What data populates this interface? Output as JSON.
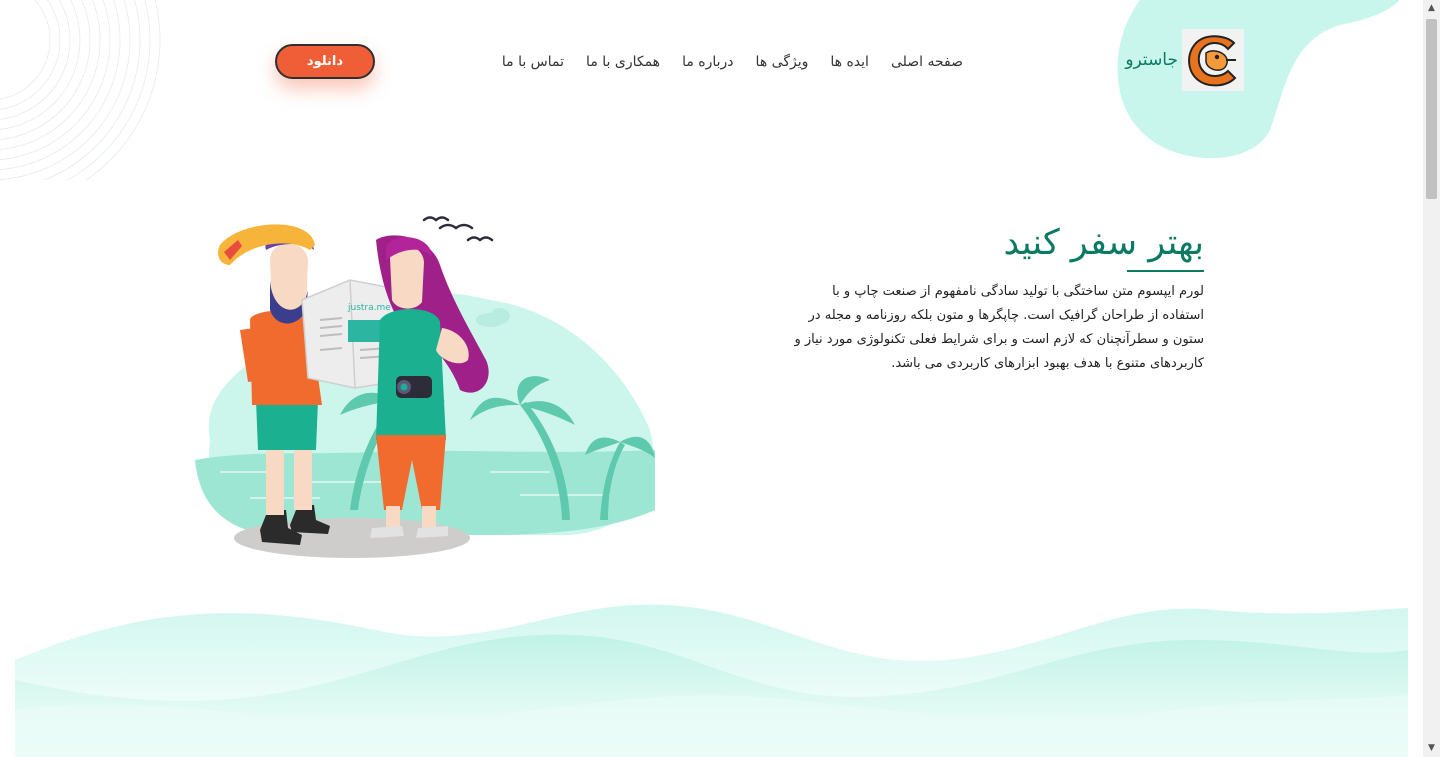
{
  "brand": {
    "name": "جاسترو",
    "logo_icon": "camel-logo-icon"
  },
  "nav": {
    "items": [
      {
        "label": "صفحه اصلی"
      },
      {
        "label": "ایده ها"
      },
      {
        "label": "ویژگی ها"
      },
      {
        "label": "درباره ما"
      },
      {
        "label": "همکاری با ما"
      },
      {
        "label": "تماس با ما"
      }
    ]
  },
  "download_label": "دانلود",
  "hero": {
    "title": "بهتر سفر کنید",
    "description": "لورم ایپسوم متن ساختگی با تولید سادگی نامفهوم از صنعت چاپ و با استفاده از طراحان گرافیک است. چاپگرها و متون بلکه روزنامه و مجله در ستون و سطرآنچنان که لازم است و برای شرایط فعلی تکنولوژی مورد نیاز و کاربردهای متنوع با هدف بهبود ابزارهای کاربردی می باشد.",
    "map_brand": "justra.me"
  },
  "colors": {
    "accent": "#0b7a62",
    "button": "#ef5e36",
    "mint": "#c9f6ec"
  }
}
